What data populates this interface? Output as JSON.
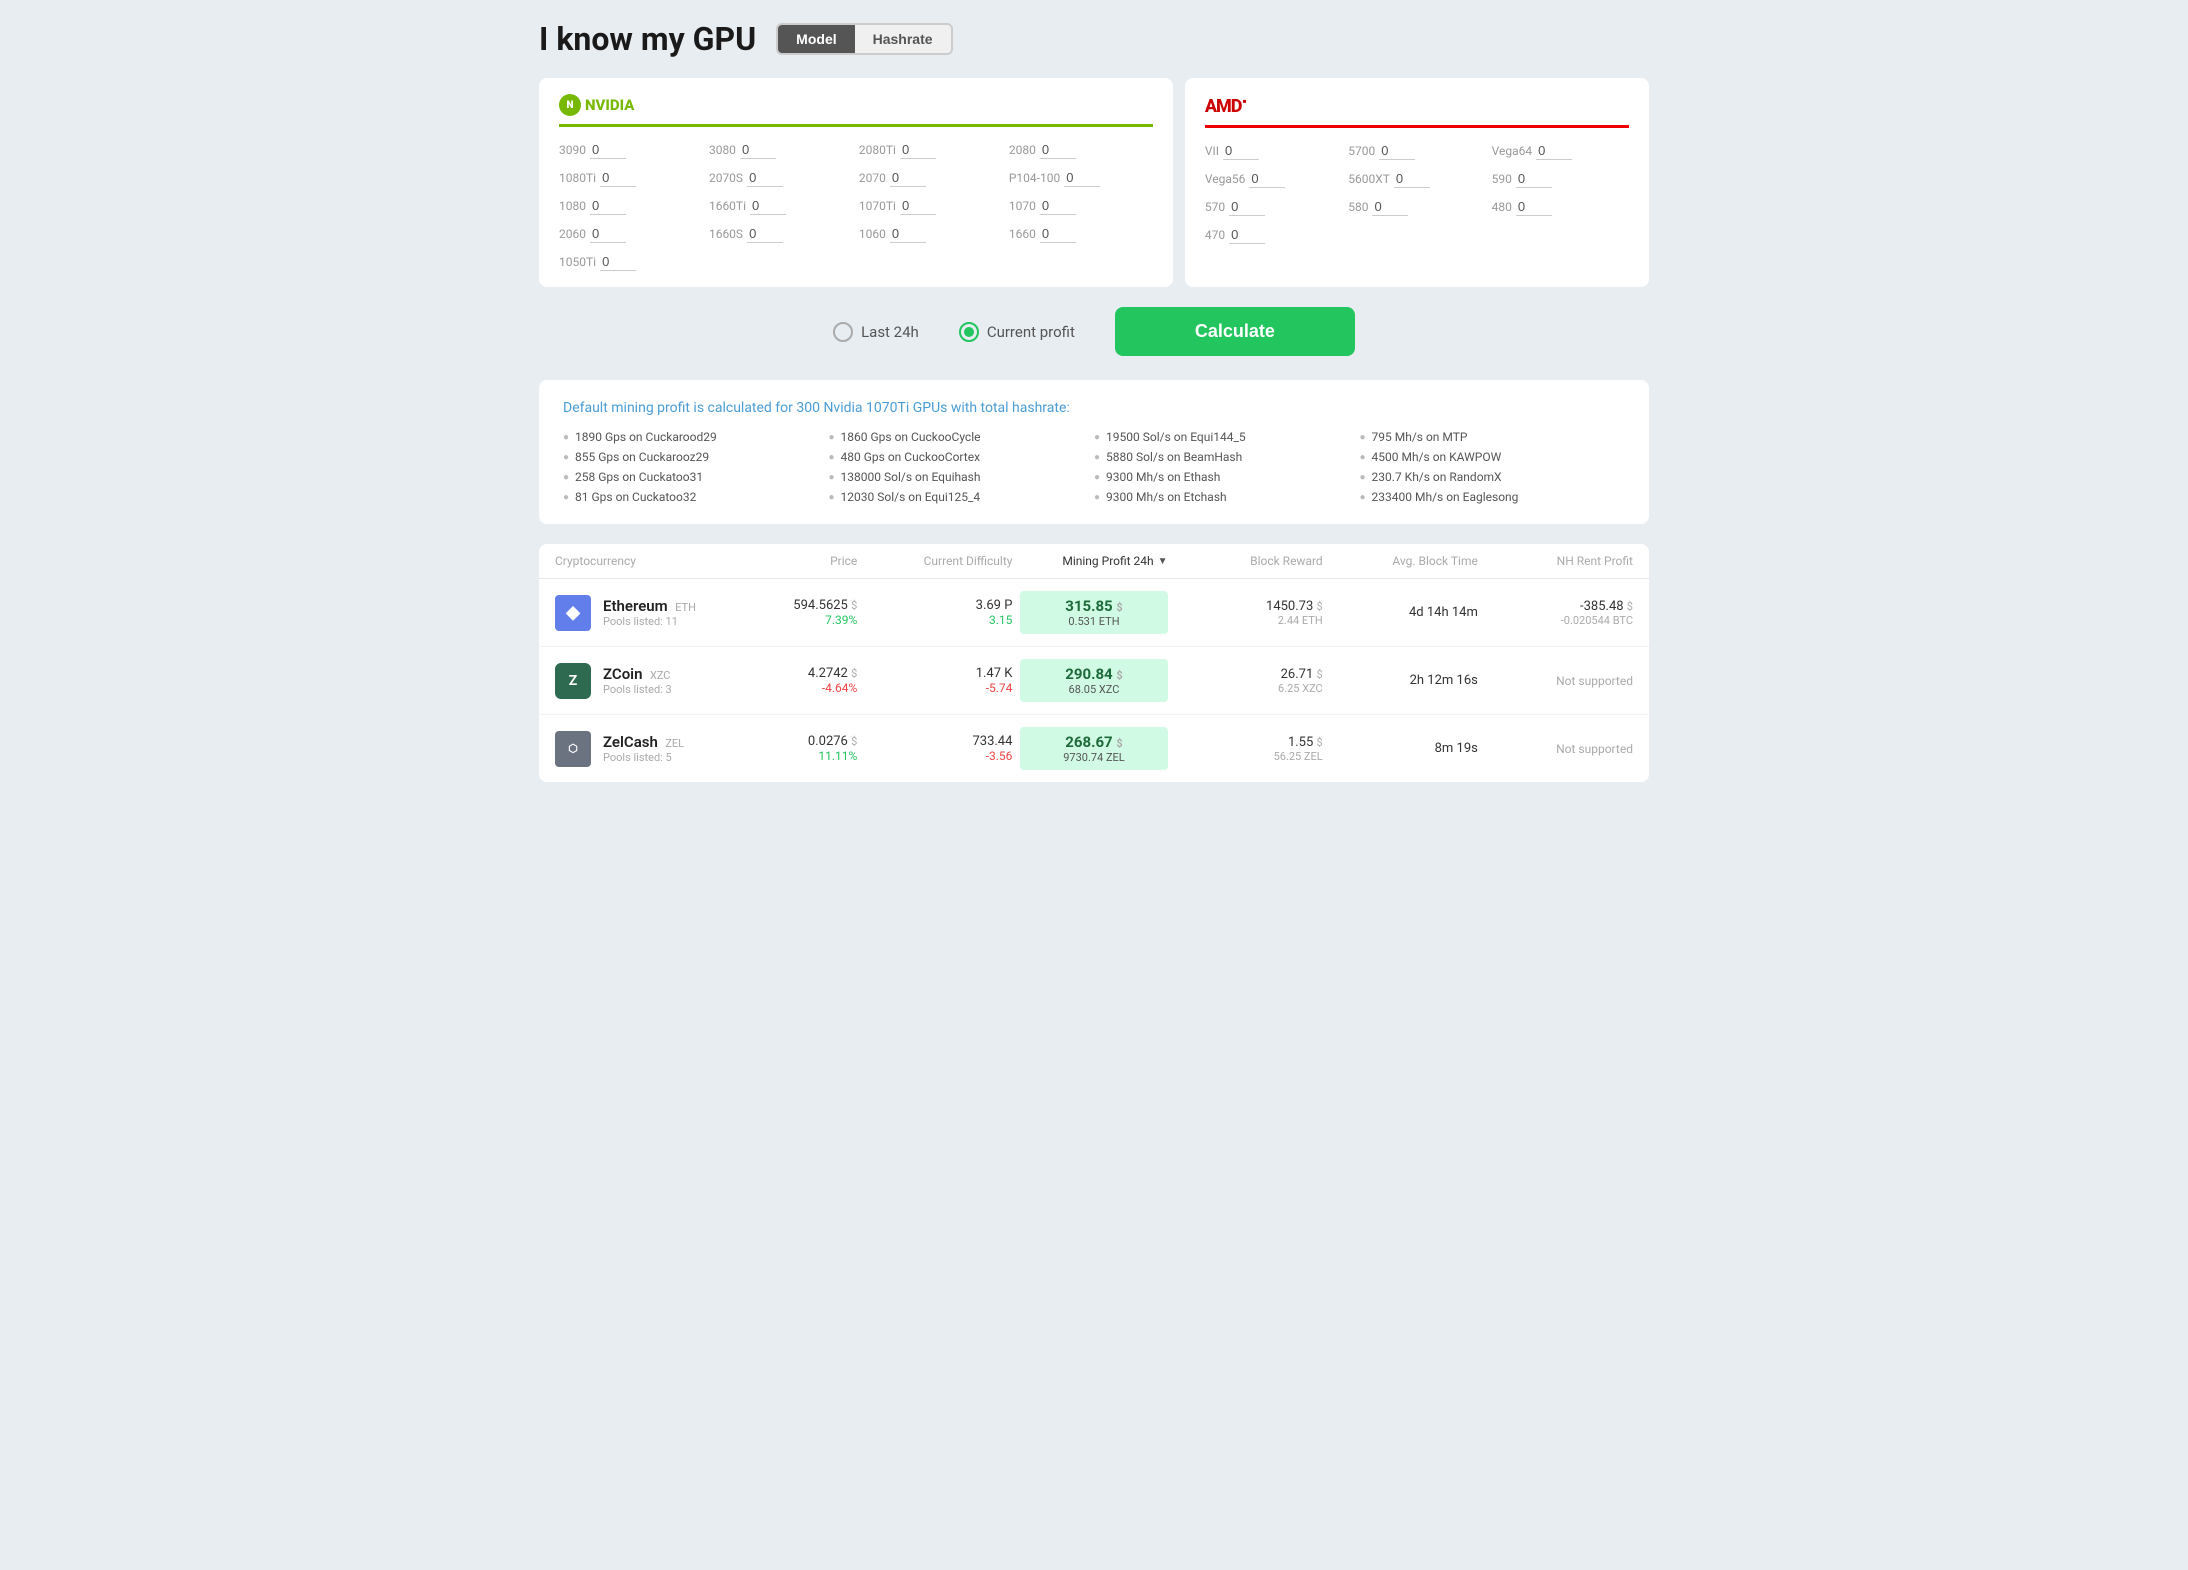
{
  "header": {
    "title": "I know my GPU",
    "toggle": {
      "option1": "Model",
      "option2": "Hashrate",
      "active": "Model"
    }
  },
  "nvidia": {
    "brand": "NVIDIA",
    "gpus": [
      {
        "label": "3090",
        "value": "0"
      },
      {
        "label": "3080",
        "value": "0"
      },
      {
        "label": "2080Ti",
        "value": "0"
      },
      {
        "label": "2080",
        "value": "0"
      },
      {
        "label": "1080Ti",
        "value": "0"
      },
      {
        "label": "2070S",
        "value": "0"
      },
      {
        "label": "2070",
        "value": "0"
      },
      {
        "label": "P104-100",
        "value": "0"
      },
      {
        "label": "1080",
        "value": "0"
      },
      {
        "label": "1660Ti",
        "value": "0"
      },
      {
        "label": "1070Ti",
        "value": "0"
      },
      {
        "label": "1070",
        "value": "0"
      },
      {
        "label": "2060",
        "value": "0"
      },
      {
        "label": "1660S",
        "value": "0"
      },
      {
        "label": "1060",
        "value": "0"
      },
      {
        "label": "1660",
        "value": "0"
      },
      {
        "label": "1050Ti",
        "value": "0"
      }
    ]
  },
  "amd": {
    "brand": "AMD",
    "gpus": [
      {
        "label": "VII",
        "value": "0"
      },
      {
        "label": "5700",
        "value": "0"
      },
      {
        "label": "Vega64",
        "value": "0"
      },
      {
        "label": "Vega56",
        "value": "0"
      },
      {
        "label": "5600XT",
        "value": "0"
      },
      {
        "label": "590",
        "value": "0"
      },
      {
        "label": "570",
        "value": "0"
      },
      {
        "label": "580",
        "value": "0"
      },
      {
        "label": "480",
        "value": "0"
      },
      {
        "label": "470",
        "value": "0"
      }
    ]
  },
  "controls": {
    "radio1": "Last 24h",
    "radio2": "Current profit",
    "radio2_selected": true,
    "calculate_btn": "Calculate"
  },
  "info_box": {
    "title": "Default mining profit is calculated for 300 Nvidia 1070Ti GPUs with total hashrate:",
    "items": [
      "1890 Gps on Cuckarood29",
      "1860 Gps on CuckooCycle",
      "19500 Sol/s on Equi144_5",
      "795 Mh/s on MTP",
      "855 Gps on Cuckarooz29",
      "480 Gps on CuckooCortex",
      "5880 Sol/s on BeamHash",
      "4500 Mh/s on KAWPOW",
      "258 Gps on Cuckatoo31",
      "138000 Sol/s on Equihash",
      "9300 Mh/s on Ethash",
      "230.7 Kh/s on RandomX",
      "81 Gps on Cuckatoo32",
      "12030 Sol/s on Equi125_4",
      "9300 Mh/s on Etchash",
      "233400 Mh/s on Eaglesong"
    ]
  },
  "table": {
    "headers": [
      "Cryptocurrency",
      "Price",
      "Current Difficulty",
      "Mining Profit 24h",
      "Block Reward",
      "Avg. Block Time",
      "NH Rent Profit"
    ],
    "rows": [
      {
        "icon_type": "eth",
        "name": "Ethereum",
        "ticker": "ETH",
        "pools": "Pools listed: 11",
        "price": "594.5625",
        "price_currency": "$",
        "change": "7.39%",
        "change_type": "up",
        "difficulty": "3.69 P",
        "difficulty_change": "3.15",
        "difficulty_change_type": "up",
        "profit": "315.85",
        "profit_currency": "$",
        "profit_sub": "0.531 ETH",
        "block_reward": "1450.73",
        "block_reward_currency": "$",
        "block_reward_sub": "2.44 ETH",
        "avg_block": "4d 14h 14m",
        "nh_profit": "-385.48",
        "nh_profit_currency": "$",
        "nh_profit_sub": "-0.020544 BTC"
      },
      {
        "icon_type": "zcoin",
        "name": "ZCoin",
        "ticker": "XZC",
        "pools": "Pools listed: 3",
        "price": "4.2742",
        "price_currency": "$",
        "change": "-4.64%",
        "change_type": "down",
        "difficulty": "1.47 K",
        "difficulty_change": "-5.74",
        "difficulty_change_type": "down",
        "profit": "290.84",
        "profit_currency": "$",
        "profit_sub": "68.05 XZC",
        "block_reward": "26.71",
        "block_reward_currency": "$",
        "block_reward_sub": "6.25 XZC",
        "avg_block": "2h 12m 16s",
        "nh_profit": null,
        "nh_profit_label": "Not supported"
      },
      {
        "icon_type": "zelcash",
        "name": "ZelCash",
        "ticker": "ZEL",
        "pools": "Pools listed: 5",
        "price": "0.0276",
        "price_currency": "$",
        "change": "11.11%",
        "change_type": "up",
        "difficulty": "733.44",
        "difficulty_change": "-3.56",
        "difficulty_change_type": "down",
        "profit": "268.67",
        "profit_currency": "$",
        "profit_sub": "9730.74 ZEL",
        "block_reward": "1.55",
        "block_reward_currency": "$",
        "block_reward_sub": "56.25 ZEL",
        "avg_block": "8m 19s",
        "nh_profit": null,
        "nh_profit_label": "Not supported"
      }
    ]
  }
}
